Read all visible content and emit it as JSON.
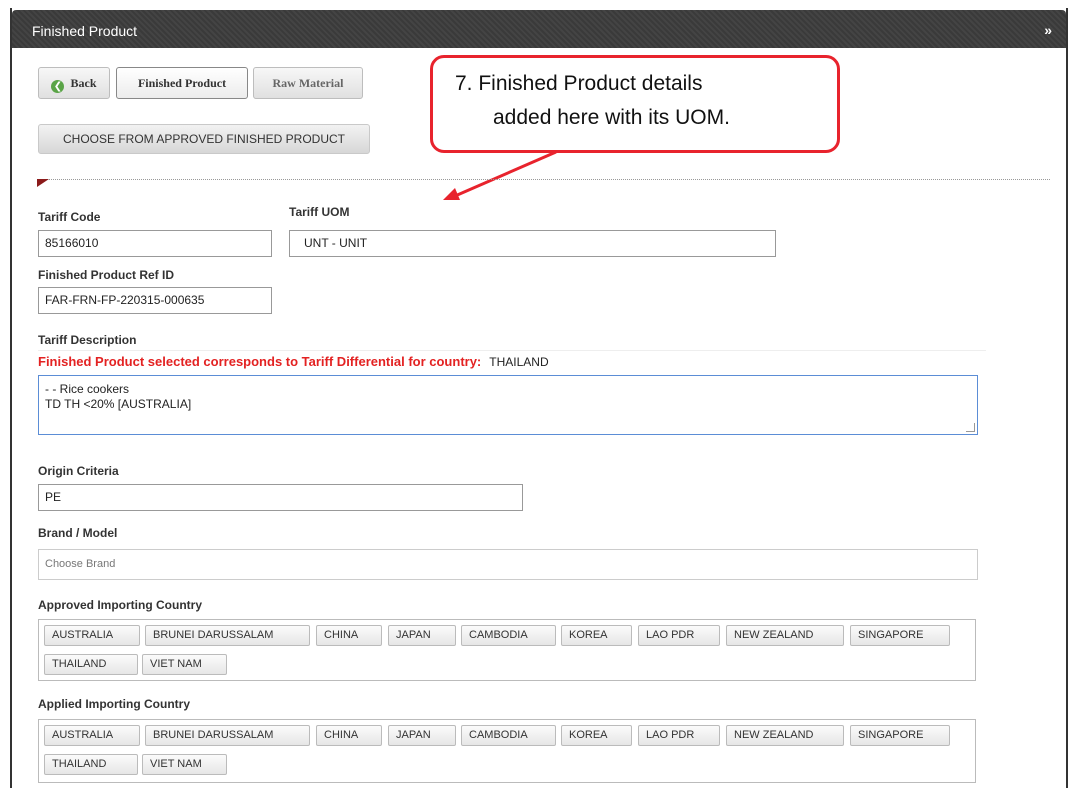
{
  "panel": {
    "title": "Finished Product",
    "collapse_icon": "double-chevron-down-icon"
  },
  "toolbar": {
    "back_label": "Back",
    "finished_product_label": "Finished Product",
    "raw_material_label": "Raw Material"
  },
  "choose_button_label": "CHOOSE FROM APPROVED FINISHED PRODUCT",
  "callout": {
    "line1": "7.  Finished Product details",
    "line2": "added here with its UOM.",
    "color": "#e8232d"
  },
  "form": {
    "tariff_code": {
      "label": "Tariff Code",
      "value": "85166010"
    },
    "tariff_uom": {
      "label": "Tariff UOM",
      "value": "UNT - UNIT"
    },
    "ref_id": {
      "label": "Finished Product Ref ID",
      "value": "FAR-FRN-FP-220315-000635"
    },
    "tariff_description": {
      "label": "Tariff Description",
      "note": "Finished Product selected corresponds to Tariff Differential for country:",
      "note_country": "THAILAND",
      "line1": "- - Rice cookers",
      "line2": "TD TH <20% [AUSTRALIA]"
    },
    "origin_criteria": {
      "label": "Origin Criteria",
      "value": "PE"
    },
    "brand_model": {
      "label": "Brand / Model",
      "placeholder": "Choose Brand"
    },
    "approved_importing": {
      "label": "Approved Importing Country",
      "countries": [
        "AUSTRALIA",
        "BRUNEI DARUSSALAM",
        "CHINA",
        "JAPAN",
        "CAMBODIA",
        "KOREA",
        "LAO PDR",
        "NEW ZEALAND",
        "SINGAPORE",
        "THAILAND",
        "VIET NAM"
      ]
    },
    "applied_importing": {
      "label": "Applied Importing Country",
      "countries": [
        "AUSTRALIA",
        "BRUNEI DARUSSALAM",
        "CHINA",
        "JAPAN",
        "CAMBODIA",
        "KOREA",
        "LAO PDR",
        "NEW ZEALAND",
        "SINGAPORE",
        "THAILAND",
        "VIET NAM"
      ]
    }
  }
}
